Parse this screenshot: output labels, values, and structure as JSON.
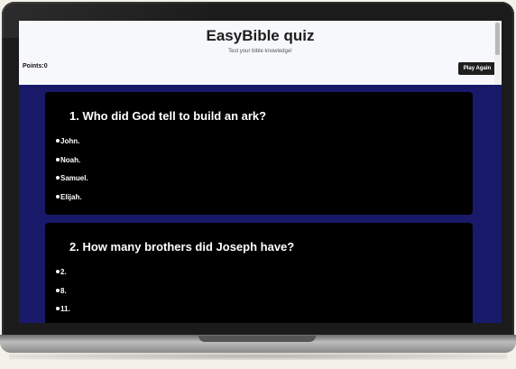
{
  "header": {
    "title": "EasyBible quiz",
    "subtitle": "Test your bible knowledge!",
    "points_label": "Points:0",
    "play_again_label": "Play Again"
  },
  "questions": [
    {
      "text": "1. Who did God tell to build an ark?",
      "options": [
        "John.",
        "Noah.",
        "Samuel.",
        "Elijah."
      ]
    },
    {
      "text": "2. How many brothers did Joseph have?",
      "options": [
        "2.",
        "8.",
        "11."
      ]
    }
  ],
  "colors": {
    "page_background": "#19196a",
    "card_background": "#000000",
    "header_background": "#f7f8fb",
    "button_background": "#1f1f1f"
  },
  "icons": {
    "option_bullet": "bullet-dot-icon"
  }
}
